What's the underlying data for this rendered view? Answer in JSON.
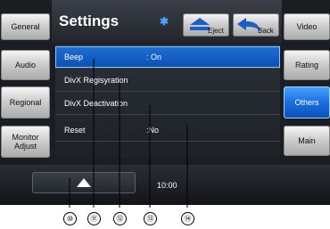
{
  "header": {
    "title": "Settings"
  },
  "top_buttons": {
    "eject_label": "Eject",
    "back_label": "Back"
  },
  "left_menu": [
    {
      "label": "General"
    },
    {
      "label": "Audio"
    },
    {
      "label": "Regional"
    },
    {
      "label": "Monitor Adjust"
    }
  ],
  "right_menu": [
    {
      "label": "Video",
      "active": false
    },
    {
      "label": "Rating",
      "active": false
    },
    {
      "label": "Others",
      "active": true
    },
    {
      "label": "Main",
      "active": false
    }
  ],
  "settings_list": [
    {
      "label": "Beep",
      "value": ": On",
      "selected": true
    },
    {
      "label": "DivX Regisyration",
      "value": "",
      "selected": false
    },
    {
      "label": "DivX Deactivation",
      "value": "",
      "selected": false
    },
    {
      "label": "Reset",
      "value": ":No",
      "selected": false
    }
  ],
  "status": {
    "time": "10:00"
  },
  "callouts": [
    "⑩",
    "⑪",
    "⑫",
    "⑬",
    "⑭"
  ],
  "colors": {
    "accent": "#1a6fe0",
    "bluetooth": "#4aa3ff"
  }
}
